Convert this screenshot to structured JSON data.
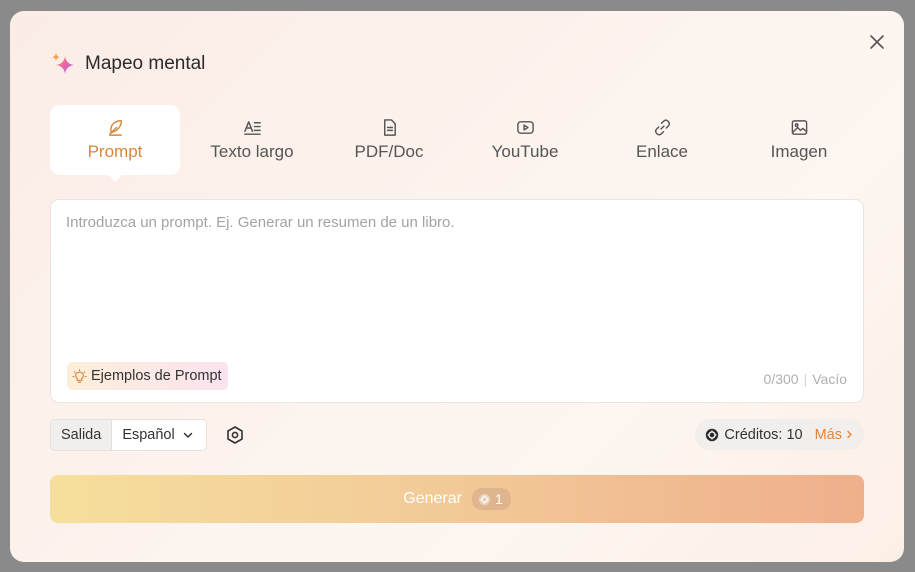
{
  "modal": {
    "title": "Mapeo mental",
    "close_icon": "close-icon",
    "title_icon": "sparkles-icon"
  },
  "tabs": [
    {
      "label": "Prompt",
      "icon": "feather-icon",
      "active": true
    },
    {
      "label": "Texto largo",
      "icon": "text-icon",
      "active": false
    },
    {
      "label": "PDF/Doc",
      "icon": "document-icon",
      "active": false
    },
    {
      "label": "YouTube",
      "icon": "youtube-icon",
      "active": false
    },
    {
      "label": "Enlace",
      "icon": "link-icon",
      "active": false
    },
    {
      "label": "Imagen",
      "icon": "image-icon",
      "active": false
    }
  ],
  "prompt": {
    "placeholder": "Introduzca un prompt. Ej. Generar un resumen de un libro.",
    "value": "",
    "examples_label": "Ejemplos de Prompt",
    "counter": "0/300",
    "counter_status": "Vacío"
  },
  "output": {
    "label": "Salida",
    "language": "Español"
  },
  "credits": {
    "label": "Créditos: 10",
    "more": "Más"
  },
  "generate": {
    "label": "Generar",
    "cost": "1"
  },
  "colors": {
    "accent": "#d98638",
    "generate_start": "#f6df9d",
    "generate_end": "#efaf8c"
  }
}
